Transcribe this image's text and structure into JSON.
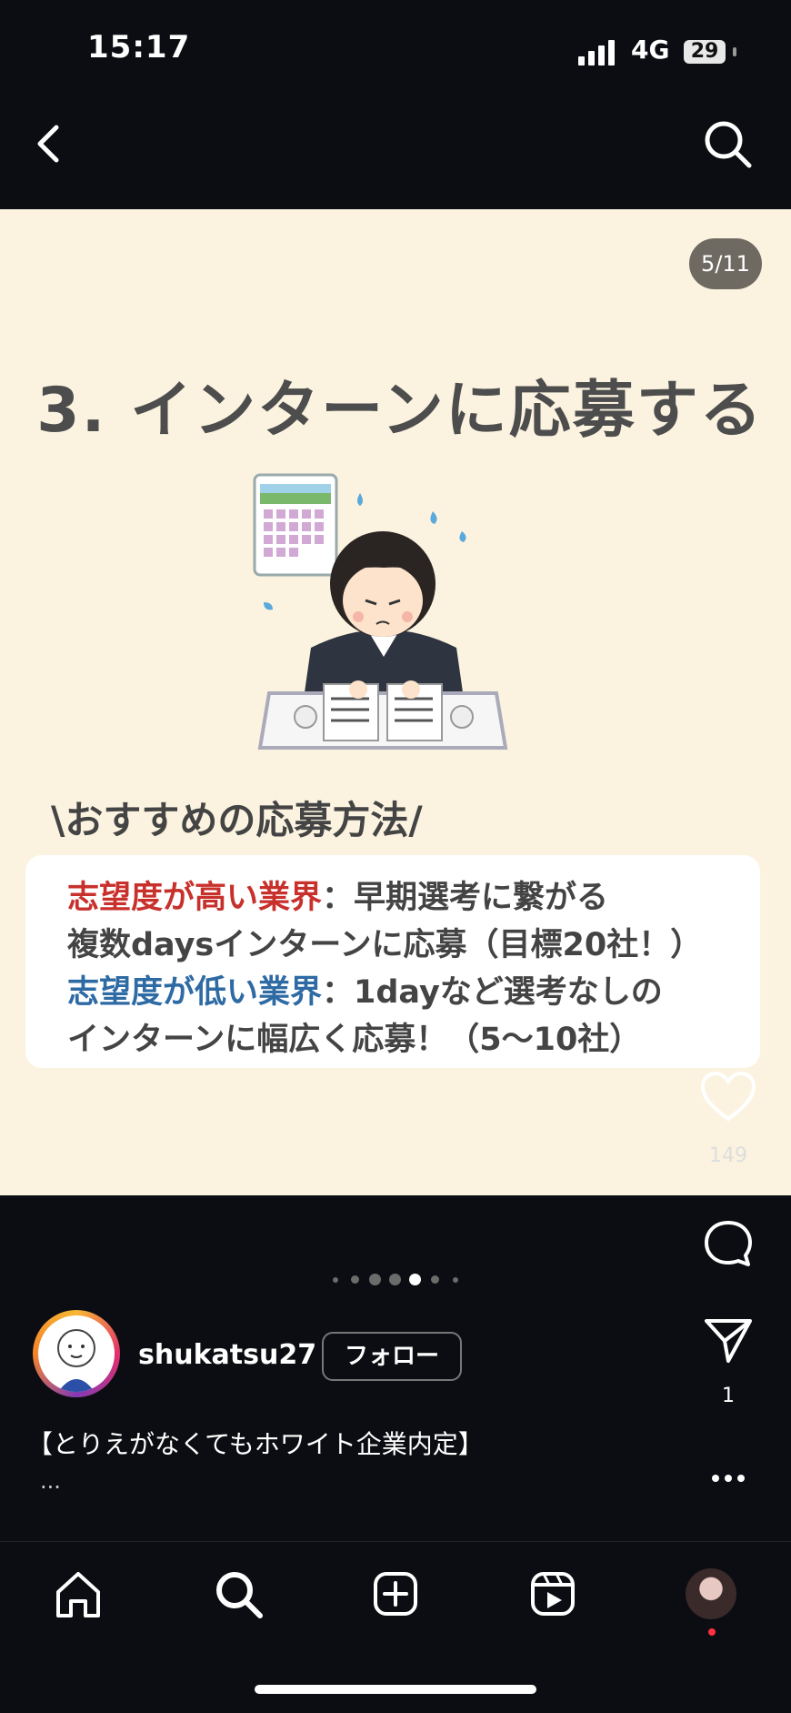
{
  "status_bar": {
    "time": "15:17",
    "network": "4G",
    "battery": "29"
  },
  "post": {
    "slide_counter": "5/11",
    "title": "3. インターンに応募する",
    "recommend_heading": "\\おすすめの応募方法/",
    "lines": [
      {
        "highlight": "志望度が高い業界",
        "text": "：早期選考に繋がる"
      },
      {
        "highlight": "",
        "text": "複数daysインターンに応募（目標20社！）"
      },
      {
        "highlight": "志望度が低い業界",
        "text": "：1dayなど選考なしの"
      },
      {
        "highlight": "",
        "text": "インターンに幅広く応募！（5〜10社）"
      }
    ],
    "colors": {
      "high": "#c8302c",
      "low": "#2e6aa3",
      "background": "#fbf3e0"
    }
  },
  "actions": {
    "like_icon": "heart-icon",
    "like_count": "149",
    "comment_icon": "comment-icon",
    "share_icon": "send-icon",
    "share_count": "1",
    "more_icon": "more-icon"
  },
  "carousel": {
    "total_dots": 7,
    "active_index": 4
  },
  "profile": {
    "username": "shukatsu27",
    "follow_label": "フォロー"
  },
  "caption": {
    "text": "【とりえがなくてもホワイト企業内定】",
    "more": "..."
  },
  "bottom_nav": [
    "home-icon",
    "search-icon",
    "create-icon",
    "reels-icon",
    "profile-avatar"
  ]
}
